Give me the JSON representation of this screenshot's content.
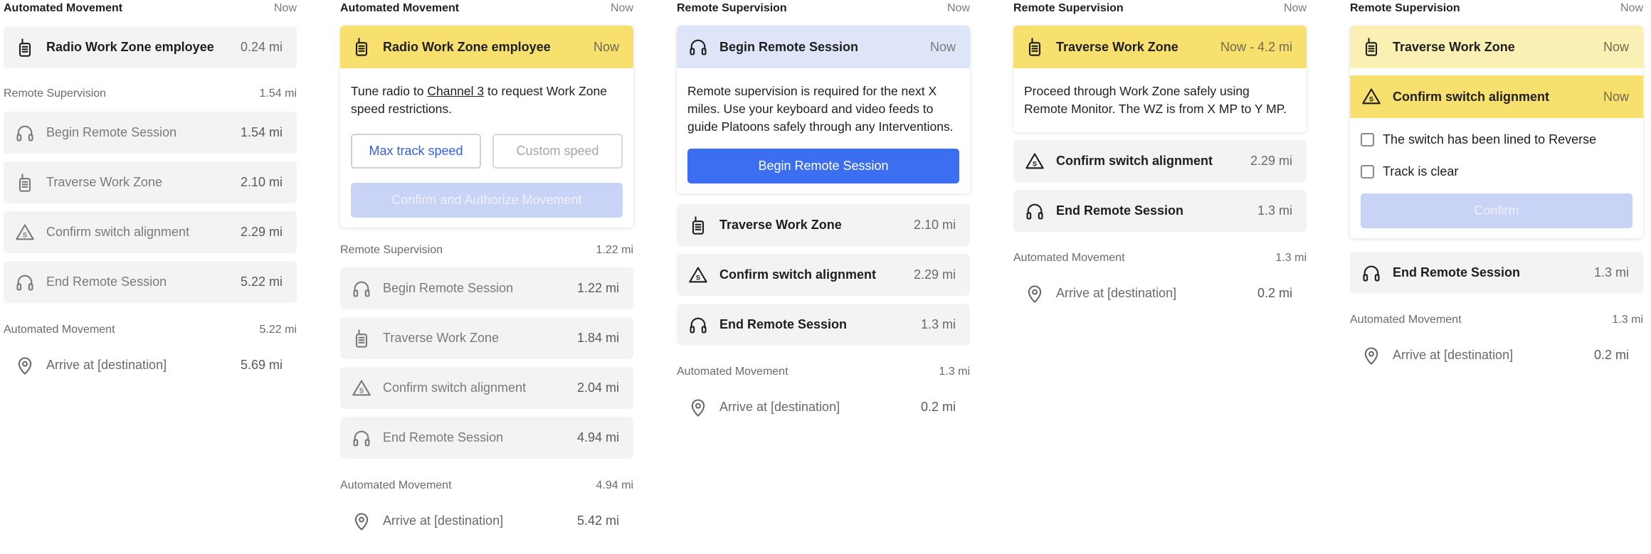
{
  "columns": [
    {
      "header": {
        "title": "Automated Movement",
        "meta": "Now"
      },
      "active_row": {
        "icon": "radio-icon",
        "label": "Radio Work Zone employee",
        "dist": "0.24 mi"
      },
      "section2": {
        "title": "Remote Supervision",
        "meta": "1.54 mi"
      },
      "rows": [
        {
          "icon": "headset-icon",
          "label": "Begin Remote Session",
          "dist": "1.54 mi"
        },
        {
          "icon": "radio-icon",
          "label": "Traverse Work Zone",
          "dist": "2.10 mi"
        },
        {
          "icon": "switch-warning-icon",
          "label": "Confirm switch alignment",
          "dist": "2.29 mi"
        },
        {
          "icon": "headset-icon",
          "label": "End Remote Session",
          "dist": "5.22 mi"
        }
      ],
      "section3": {
        "title": "Automated Movement",
        "meta": "5.22 mi"
      },
      "final_row": {
        "icon": "location-pin-icon",
        "label": "Arrive at [destination]",
        "dist": "5.69 mi"
      }
    },
    {
      "header": {
        "title": "Automated Movement",
        "meta": "Now"
      },
      "card": {
        "icon": "radio-icon",
        "label": "Radio Work Zone employee",
        "dist": "Now",
        "body_pre": "Tune radio to ",
        "body_link": "Channel 3",
        "body_post": " to request Work Zone speed restrictions.",
        "btn_max": "Max track speed",
        "btn_custom": "Custom speed",
        "btn_confirm": "Confirm and Authorize Movement"
      },
      "section2": {
        "title": "Remote Supervision",
        "meta": "1.22 mi"
      },
      "rows": [
        {
          "icon": "headset-icon",
          "label": "Begin Remote Session",
          "dist": "1.22 mi"
        },
        {
          "icon": "radio-icon",
          "label": "Traverse Work Zone",
          "dist": "1.84 mi"
        },
        {
          "icon": "switch-warning-icon",
          "label": "Confirm switch alignment",
          "dist": "2.04 mi"
        },
        {
          "icon": "headset-icon",
          "label": "End Remote Session",
          "dist": "4.94 mi"
        }
      ],
      "section3": {
        "title": "Automated Movement",
        "meta": "4.94 mi"
      },
      "final_row": {
        "icon": "location-pin-icon",
        "label": "Arrive at [destination]",
        "dist": "5.42 mi"
      }
    },
    {
      "header": {
        "title": "Remote Supervision",
        "meta": "Now"
      },
      "card": {
        "icon": "headset-icon",
        "label": "Begin Remote Session",
        "dist": "Now",
        "body": "Remote supervision is required for the next X miles. Use your keyboard and video feeds to guide Platoons safely through any Interventions.",
        "btn": "Begin Remote Session"
      },
      "rows": [
        {
          "icon": "radio-icon",
          "label": "Traverse Work Zone",
          "dist": "2.10 mi"
        },
        {
          "icon": "switch-warning-icon",
          "label": "Confirm switch alignment",
          "dist": "2.29 mi"
        },
        {
          "icon": "headset-icon",
          "label": "End Remote Session",
          "dist": "1.3 mi"
        }
      ],
      "section3": {
        "title": "Automated Movement",
        "meta": "1.3 mi"
      },
      "final_row": {
        "icon": "location-pin-icon",
        "label": "Arrive at [destination]",
        "dist": "0.2 mi"
      }
    },
    {
      "header": {
        "title": "Remote Supervision",
        "meta": "Now"
      },
      "card": {
        "icon": "radio-icon",
        "label": "Traverse Work Zone",
        "dist": "Now - 4.2 mi",
        "body": "Proceed through Work Zone safely using Remote Monitor. The WZ is from X MP to Y MP."
      },
      "rows": [
        {
          "icon": "switch-warning-icon",
          "label": "Confirm switch alignment",
          "dist": "2.29 mi"
        },
        {
          "icon": "headset-icon",
          "label": "End Remote Session",
          "dist": "1.3 mi"
        }
      ],
      "section3": {
        "title": "Automated Movement",
        "meta": "1.3 mi"
      },
      "final_row": {
        "icon": "location-pin-icon",
        "label": "Arrive at [destination]",
        "dist": "0.2 mi"
      }
    },
    {
      "header": {
        "title": "Remote Supervision",
        "meta": "Now"
      },
      "card": {
        "top_icon": "radio-icon",
        "top_label": "Traverse Work Zone",
        "top_dist": "Now",
        "icon": "switch-warning-icon",
        "label": "Confirm switch alignment",
        "dist": "Now",
        "check1": "The switch has been lined to Reverse",
        "check2": "Track is clear",
        "btn": "Confirm"
      },
      "rows": [
        {
          "icon": "headset-icon",
          "label": "End Remote Session",
          "dist": "1.3 mi"
        }
      ],
      "section3": {
        "title": "Automated Movement",
        "meta": "1.3 mi"
      },
      "final_row": {
        "icon": "location-pin-icon",
        "label": "Arrive at [destination]",
        "dist": "0.2 mi"
      }
    }
  ]
}
